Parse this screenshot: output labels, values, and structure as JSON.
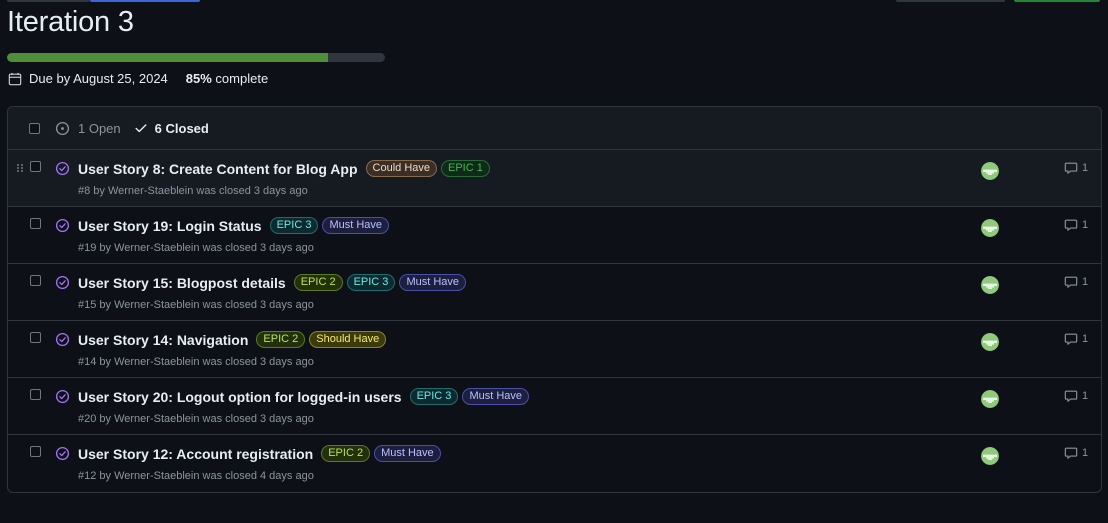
{
  "milestone": {
    "title": "Iteration 3",
    "progress": 0.85,
    "due": "Due by August 25, 2024",
    "percent": "85%",
    "complete_suffix": " complete"
  },
  "header": {
    "open_label": "1 Open",
    "closed_label": "6 Closed"
  },
  "issues": [
    {
      "title": "User Story 8: Create Content for Blog App",
      "labels": [
        {
          "text": "Could Have",
          "variant": "could"
        },
        {
          "text": "EPIC 1",
          "variant": "epic1"
        }
      ],
      "meta": "#8 by Werner-Staeblein was closed 3 days ago",
      "comments": "1"
    },
    {
      "title": "User Story 19: Login Status",
      "labels": [
        {
          "text": "EPIC 3",
          "variant": "epic3"
        },
        {
          "text": "Must Have",
          "variant": "must"
        }
      ],
      "meta": "#19 by Werner-Staeblein was closed 3 days ago",
      "comments": "1"
    },
    {
      "title": "User Story 15: Blogpost details",
      "labels": [
        {
          "text": "EPIC 2",
          "variant": "epic2"
        },
        {
          "text": "EPIC 3",
          "variant": "epic3"
        },
        {
          "text": "Must Have",
          "variant": "must"
        }
      ],
      "meta": "#15 by Werner-Staeblein was closed 3 days ago",
      "comments": "1"
    },
    {
      "title": "User Story 14: Navigation",
      "labels": [
        {
          "text": "EPIC 2",
          "variant": "epic2"
        },
        {
          "text": "Should Have",
          "variant": "should"
        }
      ],
      "meta": "#14 by Werner-Staeblein was closed 3 days ago",
      "comments": "1"
    },
    {
      "title": "User Story 20: Logout option for logged-in users",
      "labels": [
        {
          "text": "EPIC 3",
          "variant": "epic3"
        },
        {
          "text": "Must Have",
          "variant": "must"
        }
      ],
      "meta": "#20 by Werner-Staeblein was closed 3 days ago",
      "comments": "1"
    },
    {
      "title": "User Story 12: Account registration",
      "labels": [
        {
          "text": "EPIC 2",
          "variant": "epic2"
        },
        {
          "text": "Must Have",
          "variant": "must"
        }
      ],
      "meta": "#12 by Werner-Staeblein was closed 4 days ago",
      "comments": "1"
    }
  ],
  "label_colors": {
    "could": {
      "bg": "#3a2f26",
      "fg": "#f0d9c2",
      "border": "#8a6a4c"
    },
    "epic1": {
      "bg": "#0f2a19",
      "fg": "#3fb950",
      "border": "#2a6a37"
    },
    "epic2": {
      "bg": "#22300c",
      "fg": "#b6e35a",
      "border": "#5a7a20"
    },
    "epic3": {
      "bg": "#0c2a30",
      "fg": "#6ee7e0",
      "border": "#1f6d6f"
    },
    "must": {
      "bg": "#1c1f3d",
      "fg": "#b9c0ff",
      "border": "#4850a8"
    },
    "should": {
      "bg": "#3a3a0c",
      "fg": "#f5e96a",
      "border": "#8a8520"
    }
  },
  "colors": {
    "closed_status": "#a371f7",
    "progress_fill": "#4f8f3a"
  }
}
